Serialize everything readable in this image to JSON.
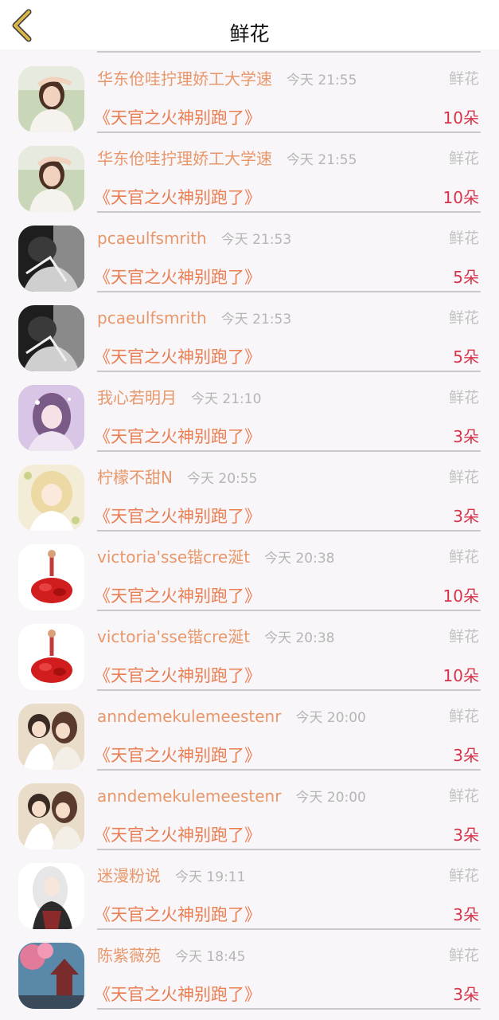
{
  "header": {
    "title": "鲜花",
    "back_icon": "chevron-left-icon",
    "accent": "#c9a640"
  },
  "colors": {
    "name": "#e8976a",
    "book": "#ea7d52",
    "amount": "#d9334a",
    "muted": "#b5b5b5"
  },
  "items": [
    {
      "name": "华东伧哇拧理娇工大学速",
      "time": "今天 21:55",
      "type": "鲜花",
      "book": "《天官之火神别跑了》",
      "amount": "10朵",
      "avatar": "avatar-girl-photo"
    },
    {
      "name": "华东伧哇拧理娇工大学速",
      "time": "今天 21:55",
      "type": "鲜花",
      "book": "《天官之火神别跑了》",
      "amount": "10朵",
      "avatar": "avatar-girl-photo"
    },
    {
      "name": "pcaeulfsmrith",
      "time": "今天 21:53",
      "type": "鲜花",
      "book": "《天官之火神别跑了》",
      "amount": "5朵",
      "avatar": "avatar-bw-photo"
    },
    {
      "name": "pcaeulfsmrith",
      "time": "今天 21:53",
      "type": "鲜花",
      "book": "《天官之火神别跑了》",
      "amount": "5朵",
      "avatar": "avatar-bw-photo"
    },
    {
      "name": "我心若明月",
      "time": "今天 21:10",
      "type": "鲜花",
      "book": "《天官之火神别跑了》",
      "amount": "3朵",
      "avatar": "avatar-anime-purple"
    },
    {
      "name": "柠檬不甜N",
      "time": "今天 20:55",
      "type": "鲜花",
      "book": "《天官之火神别跑了》",
      "amount": "3朵",
      "avatar": "avatar-anime-blonde"
    },
    {
      "name": "victoria'sse锴cre涎t",
      "time": "今天 20:38",
      "type": "鲜花",
      "book": "《天官之火神别跑了》",
      "amount": "10朵",
      "avatar": "avatar-red-dress"
    },
    {
      "name": "victoria'sse锴cre涎t",
      "time": "今天 20:38",
      "type": "鲜花",
      "book": "《天官之火神别跑了》",
      "amount": "10朵",
      "avatar": "avatar-red-dress"
    },
    {
      "name": "anndemekulemeestenr",
      "time": "今天 20:00",
      "type": "鲜花",
      "book": "《天官之火神别跑了》",
      "amount": "3朵",
      "avatar": "avatar-couple"
    },
    {
      "name": "anndemekulemeestenr",
      "time": "今天 20:00",
      "type": "鲜花",
      "book": "《天官之火神别跑了》",
      "amount": "3朵",
      "avatar": "avatar-couple"
    },
    {
      "name": "迷漫粉说",
      "time": "今天 19:11",
      "type": "鲜花",
      "book": "《天官之火神别跑了》",
      "amount": "3朵",
      "avatar": "avatar-anime-white-hair"
    },
    {
      "name": "陈紫薇苑",
      "time": "今天 18:45",
      "type": "鲜花",
      "book": "《天官之火神别跑了》",
      "amount": "3朵",
      "avatar": "avatar-pagoda"
    }
  ]
}
